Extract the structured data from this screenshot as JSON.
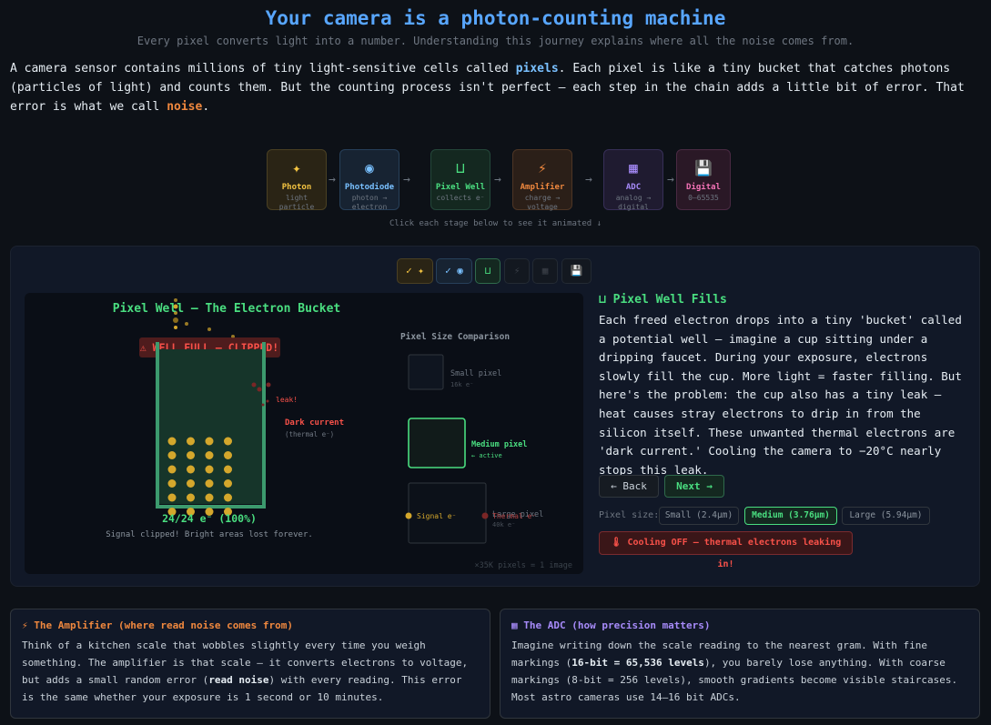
{
  "header": {
    "title": "Your camera is a photon-counting machine",
    "subtitle": "Every pixel converts light into a number. Understanding this journey explains where all the noise comes from."
  },
  "intro": {
    "p1": "A camera sensor contains millions of tiny light-sensitive cells called ",
    "pixels": "pixels",
    "p2": ". Each pixel is like a tiny bucket that catches photons (particles of light) and counts them. But the counting process isn't perfect — each step in the chain adds a little bit of error. That error is what we call ",
    "noise": "noise",
    "p3": "."
  },
  "pipeline": {
    "stages": [
      {
        "icon": "✦",
        "name": "Photon",
        "sub": "light particle",
        "color": "#f5c542",
        "bg": "#2a2415",
        "border": "#4a4023"
      },
      {
        "icon": "◉",
        "name": "Photodiode",
        "sub": "photon → electron",
        "color": "#79c0ff",
        "bg": "#172332",
        "border": "#27405a"
      },
      {
        "icon": "⊔",
        "name": "Pixel Well",
        "sub": "collects e⁻",
        "color": "#4ade80",
        "bg": "#142820",
        "border": "#24473a"
      },
      {
        "icon": "⚡",
        "name": "Amplifier",
        "sub": "charge → voltage",
        "color": "#f0883e",
        "bg": "#2b1f18",
        "border": "#4d3524"
      },
      {
        "icon": "▦",
        "name": "ADC",
        "sub": "analog → digital",
        "color": "#a78bfa",
        "bg": "#1f1b30",
        "border": "#372f57"
      },
      {
        "icon": "💾",
        "name": "Digital",
        "sub": "0–65535",
        "color": "#f472b6",
        "bg": "#2a1826",
        "border": "#4a2a43"
      }
    ],
    "hint": "Click each stage below to see it animated ↓"
  },
  "tabs": [
    {
      "label": "✓ ✦",
      "color": "#f5c542",
      "bg": "#2a2415",
      "border": "#4a4023"
    },
    {
      "label": "✓ ◉",
      "color": "#79c0ff",
      "bg": "#172332",
      "border": "#27405a"
    },
    {
      "label": "⊔",
      "color": "#4ade80",
      "bg": "#142820",
      "border": "#2f6a4c"
    },
    {
      "label": "⚡",
      "color": "#3a3f47",
      "bg": "#131820",
      "border": "#232a33"
    },
    {
      "label": "▦",
      "color": "#3a3f47",
      "bg": "#131820",
      "border": "#232a33"
    },
    {
      "label": "💾",
      "color": "#6e7681",
      "bg": "#131820",
      "border": "#232a33"
    }
  ],
  "canvas": {
    "title": "Pixel Well — The Electron Bucket",
    "well_full": "⚠ WELL FULL — CLIPPED!",
    "leak": "leak!",
    "dark_current": "Dark current",
    "dark_current_sub": "(thermal e⁻)",
    "fill_readout": "24/24 e⁻ (100%)",
    "fill_fraction": 1.0,
    "clipped_note": "Signal clipped! Bright areas lost forever.",
    "comparison_title": "Pixel Size Comparison",
    "small_label": "Small pixel",
    "small_cap": "16k e⁻",
    "medium_label": "Medium pixel",
    "medium_sub": "← active",
    "large_label": "Large pixel",
    "large_cap": "40k e⁻",
    "signal_legend": "Signal e⁻",
    "thermal_legend": "Thermal e⁻",
    "footer": "×35K pixels = 1 image"
  },
  "description": {
    "title": "⊔ Pixel Well Fills",
    "body": "Each freed electron drops into a tiny 'bucket' called a potential well — imagine a cup sitting under a dripping faucet. During your exposure, electrons slowly fill the cup. More light = faster filling. But here's the problem: the cup also has a tiny leak — heat causes stray electrons to drip in from the silicon itself. These unwanted thermal electrons are 'dark current.' Cooling the camera to −20°C nearly stops this leak."
  },
  "controls": {
    "back": "← Back",
    "next": "Next →",
    "pixel_size_label": "Pixel size:",
    "sizes": [
      "Small (2.4μm)",
      "Medium (3.76μm)",
      "Large (5.94μm)"
    ],
    "selected_size": "Medium (3.76μm)",
    "cooling": "🌡 Cooling OFF — thermal electrons leaking in!"
  },
  "cards": {
    "amp_title": "⚡ The Amplifier (where read noise comes from)",
    "amp_1": "Think of a kitchen scale that wobbles slightly every time you weigh something. The amplifier is that scale — it converts electrons to voltage, but adds a small random error (",
    "amp_bold": "read noise",
    "amp_2": ") with every reading. This error is the same whether your exposure is 1 second or 10 minutes.",
    "adc_title": "▦ The ADC (how precision matters)",
    "adc_1": "Imagine writing down the scale reading to the nearest gram. With fine markings (",
    "adc_bold": "16-bit = 65,536 levels",
    "adc_2": "), you barely lose anything. With coarse markings (8-bit = 256 levels), smooth gradients become visible staircases. Most astro cameras use 14–16 bit ADCs."
  },
  "colors": {
    "accent_blue": "#58a6ff",
    "green": "#4ade80",
    "orange": "#f0883e",
    "red": "#f85149",
    "electron": "#d4a72c",
    "purple": "#a78bfa"
  }
}
